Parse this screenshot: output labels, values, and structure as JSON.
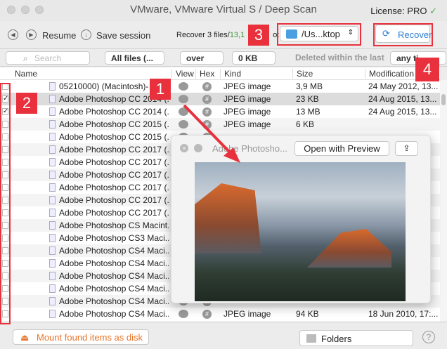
{
  "window": {
    "title": "VMware, VMware Virtual S / Deep Scan",
    "license": "License: PRO"
  },
  "toolbar": {
    "resume": "Resume",
    "save_session": "Save session",
    "recover_prefix": "Recover 3 files/",
    "recover_count": "13,1",
    "recover_suffix": "o:",
    "destination": "/Us...ktop",
    "recover_button": "Recover"
  },
  "filter": {
    "search_placeholder": "Search",
    "file_type": "All files (...",
    "size_op": "over",
    "size_val": "0 KB",
    "deleted_label": "Deleted within the last",
    "time": "any ti"
  },
  "columns": {
    "name": "Name",
    "view": "View",
    "hex": "Hex",
    "kind": "Kind",
    "size": "Size",
    "modified": "Modification d"
  },
  "rows": [
    {
      "name": "05210000)  (Macintosh)-",
      "kind": "JPEG image",
      "size": "3,9 MB",
      "modified": "24 May 2012, 13...",
      "checked": false
    },
    {
      "name": "Adobe Photoshop CC 2014 (...",
      "kind": "JPEG image",
      "size": "23 KB",
      "modified": "24 Aug 2015, 13...",
      "checked": true
    },
    {
      "name": "Adobe Photoshop CC 2014 (...",
      "kind": "JPEG image",
      "size": "13 MB",
      "modified": "24 Aug 2015, 13...",
      "checked": true
    },
    {
      "name": "Adobe Photoshop CC 2015 (...",
      "kind": "JPEG image",
      "size": "6 KB",
      "modified": "",
      "checked": false
    },
    {
      "name": "Adobe Photoshop CC 2015 (...",
      "kind": "",
      "size": "",
      "modified": "",
      "checked": false
    },
    {
      "name": "Adobe Photoshop CC 2017 (...",
      "kind": "",
      "size": "",
      "modified": "",
      "checked": false
    },
    {
      "name": "Adobe Photoshop CC 2017 (...",
      "kind": "",
      "size": "",
      "modified": "",
      "checked": false
    },
    {
      "name": "Adobe Photoshop CC 2017 (...",
      "kind": "",
      "size": "",
      "modified": "",
      "checked": false
    },
    {
      "name": "Adobe Photoshop CC 2017 (...",
      "kind": "",
      "size": "",
      "modified": "",
      "checked": false
    },
    {
      "name": "Adobe Photoshop CC 2017 (...",
      "kind": "",
      "size": "",
      "modified": "",
      "checked": false
    },
    {
      "name": "Adobe Photoshop CC 2017 (...",
      "kind": "",
      "size": "",
      "modified": "",
      "checked": false
    },
    {
      "name": "Adobe Photoshop CS Macint...",
      "kind": "",
      "size": "",
      "modified": "",
      "checked": false
    },
    {
      "name": "Adobe Photoshop CS3 Maci...",
      "kind": "",
      "size": "",
      "modified": "",
      "checked": false
    },
    {
      "name": "Adobe Photoshop CS4 Maci...",
      "kind": "",
      "size": "",
      "modified": "",
      "checked": false
    },
    {
      "name": "Adobe Photoshop CS4 Maci...",
      "kind": "",
      "size": "",
      "modified": "",
      "checked": false
    },
    {
      "name": "Adobe Photoshop CS4 Maci...",
      "kind": "",
      "size": "",
      "modified": "",
      "checked": false
    },
    {
      "name": "Adobe Photoshop CS4 Maci...",
      "kind": "",
      "size": "",
      "modified": "",
      "checked": false
    },
    {
      "name": "Adobe Photoshop CS4 Maci...",
      "kind": "",
      "size": "",
      "modified": "",
      "checked": false
    },
    {
      "name": "Adobe Photoshop CS4 Maci...",
      "kind": "JPEG image",
      "size": "94 KB",
      "modified": "18 Jun 2010, 17:...",
      "checked": false
    }
  ],
  "preview": {
    "title": "Adobe Photosho...",
    "open_button": "Open with Preview"
  },
  "bottom": {
    "mount": "Mount found items as disk",
    "view_mode": "Folders",
    "help": "?"
  },
  "annotations": [
    "1",
    "2",
    "3",
    "4"
  ],
  "colors": {
    "accent": "#2a7fd4",
    "annotation": "#e8313c",
    "mount": "#e8742a",
    "count": "#3a9a3a"
  }
}
